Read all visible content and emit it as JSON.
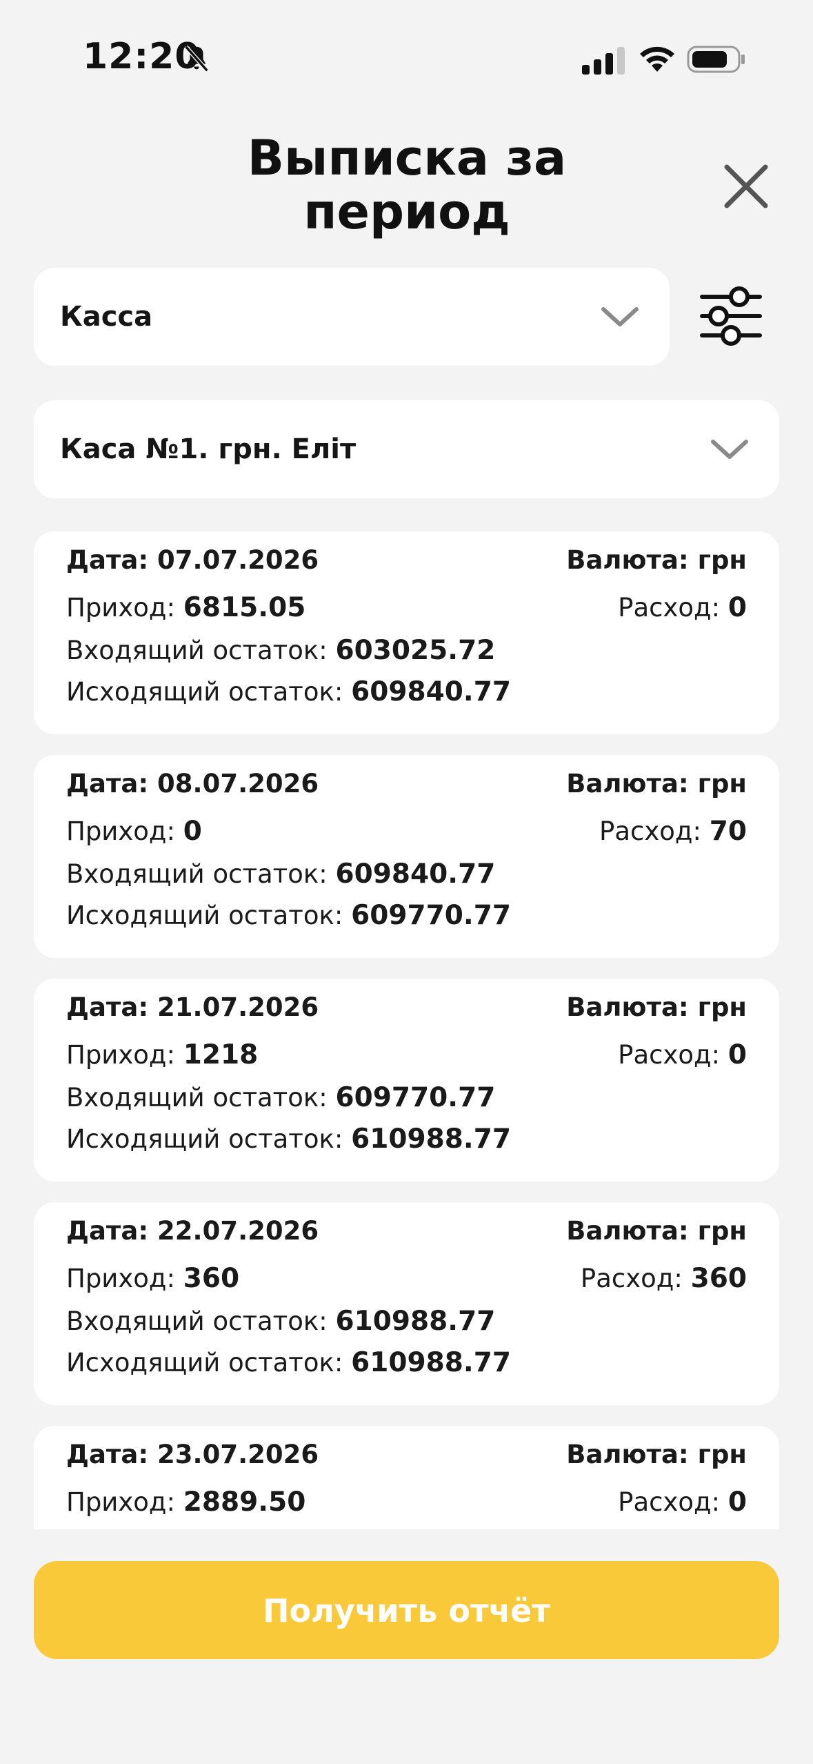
{
  "status_bar": {
    "time": "12:20",
    "icons": [
      "bell-slash-icon",
      "cellular-signal-icon",
      "wifi-icon",
      "battery-icon"
    ]
  },
  "header": {
    "title_line1": "Выписка за",
    "title_line2": "период",
    "close_icon": "close-icon"
  },
  "filters": {
    "type_select": "Касса",
    "cash_select": "Каса №1. грн. Еліт",
    "filter_icon": "sliders-icon"
  },
  "labels": {
    "date": "Дата:",
    "currency": "Валюта:",
    "income": "Приход:",
    "expense": "Расход:",
    "opening": "Входящий остаток:",
    "closing": "Исходящий остаток:"
  },
  "entries": [
    {
      "date": "07.07.2026",
      "currency": "грн",
      "income": "6815.05",
      "expense": "0",
      "opening": "603025.72",
      "closing": "609840.77"
    },
    {
      "date": "08.07.2026",
      "currency": "грн",
      "income": "0",
      "expense": "70",
      "opening": "609840.77",
      "closing": "609770.77"
    },
    {
      "date": "21.07.2026",
      "currency": "грн",
      "income": "1218",
      "expense": "0",
      "opening": "609770.77",
      "closing": "610988.77"
    },
    {
      "date": "22.07.2026",
      "currency": "грн",
      "income": "360",
      "expense": "360",
      "opening": "610988.77",
      "closing": "610988.77"
    },
    {
      "date": "23.07.2026",
      "currency": "грн",
      "income": "2889.50",
      "expense": "0"
    }
  ],
  "actions": {
    "submit_label": "Получить отчёт"
  },
  "colors": {
    "background": "#f3f3f3",
    "card": "#ffffff",
    "accent": "#f9c93a",
    "chevron": "#8a8a8a"
  }
}
